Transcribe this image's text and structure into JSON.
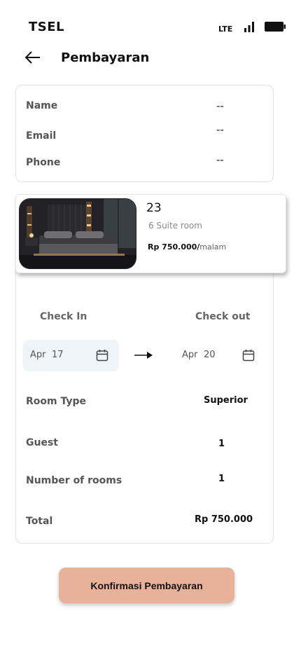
{
  "status_bar": {
    "carrier": "TSEL",
    "network": "LTE"
  },
  "header": {
    "title": "Pembayaran"
  },
  "customer": {
    "name_label": "Name",
    "name_value": "--",
    "email_label": "Email",
    "email_value": "--",
    "phone_label": "Phone",
    "phone_value": "--"
  },
  "room": {
    "number": "23",
    "name": "6 Suite room",
    "price": "Rp 750.000/",
    "price_unit": "malam"
  },
  "dates": {
    "checkin_label": "Check In",
    "checkout_label": "Check out",
    "checkin_month": "Apr",
    "checkin_day": "17",
    "checkout_month": "Apr",
    "checkout_day": "20"
  },
  "details": {
    "room_type_label": "Room Type",
    "room_type_value": "Superior",
    "guest_label": "Guest",
    "guest_value": "1",
    "rooms_label": "Number of rooms",
    "rooms_value": "1",
    "total_label": "Total",
    "total_value": "Rp 750.000"
  },
  "actions": {
    "confirm_label": "Konfirmasi Pembayaran"
  },
  "colors": {
    "confirm_button": "#e8b19a",
    "date_box": "#eef4f8"
  }
}
